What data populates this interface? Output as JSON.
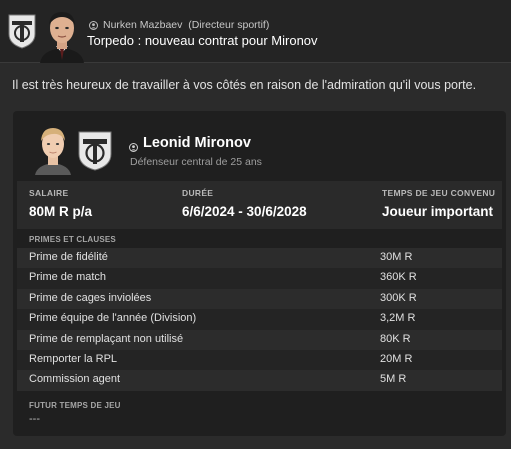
{
  "message": {
    "sender": "Nurken Mazbaev",
    "sender_role": "(Directeur sportif)",
    "title": "Torpedo : nouveau contrat pour Mironov",
    "body": "Il est très heureux de travailler à vos côtés en raison de l'admiration qu'il vous porte."
  },
  "player": {
    "name": "Leonid Mironov",
    "description": "Défenseur central de 25 ans"
  },
  "contract": {
    "salary_label": "SALAIRE",
    "salary_value": "80M R p/a",
    "duration_label": "DURÉE",
    "duration_value": "6/6/2024 - 30/6/2028",
    "playtime_label": "TEMPS DE JEU CONVENU",
    "playtime_value": "Joueur important"
  },
  "bonuses": {
    "section_title": "PRIMES ET CLAUSES",
    "items": [
      {
        "name": "Prime de fidélité",
        "value": "30M R"
      },
      {
        "name": "Prime de match",
        "value": "360K R"
      },
      {
        "name": "Prime de cages inviolées",
        "value": "300K R"
      },
      {
        "name": "Prime équipe de l'année (Division)",
        "value": "3,2M R"
      },
      {
        "name": "Prime de remplaçant non utilisé",
        "value": "80K R"
      },
      {
        "name": "Remporter la RPL",
        "value": "20M R"
      },
      {
        "name": "Commission agent",
        "value": "5M R"
      }
    ]
  },
  "future": {
    "section_title": "FUTUR TEMPS DE JEU",
    "value": "---"
  },
  "icons": {
    "club_badge": "torpedo-badge-icon",
    "person": "person-icon"
  },
  "colors": {
    "background": "#2b2b2b",
    "header": "#242424",
    "card": "#1f1f1f",
    "text": "#ffffff",
    "muted": "#9e9e9e"
  }
}
